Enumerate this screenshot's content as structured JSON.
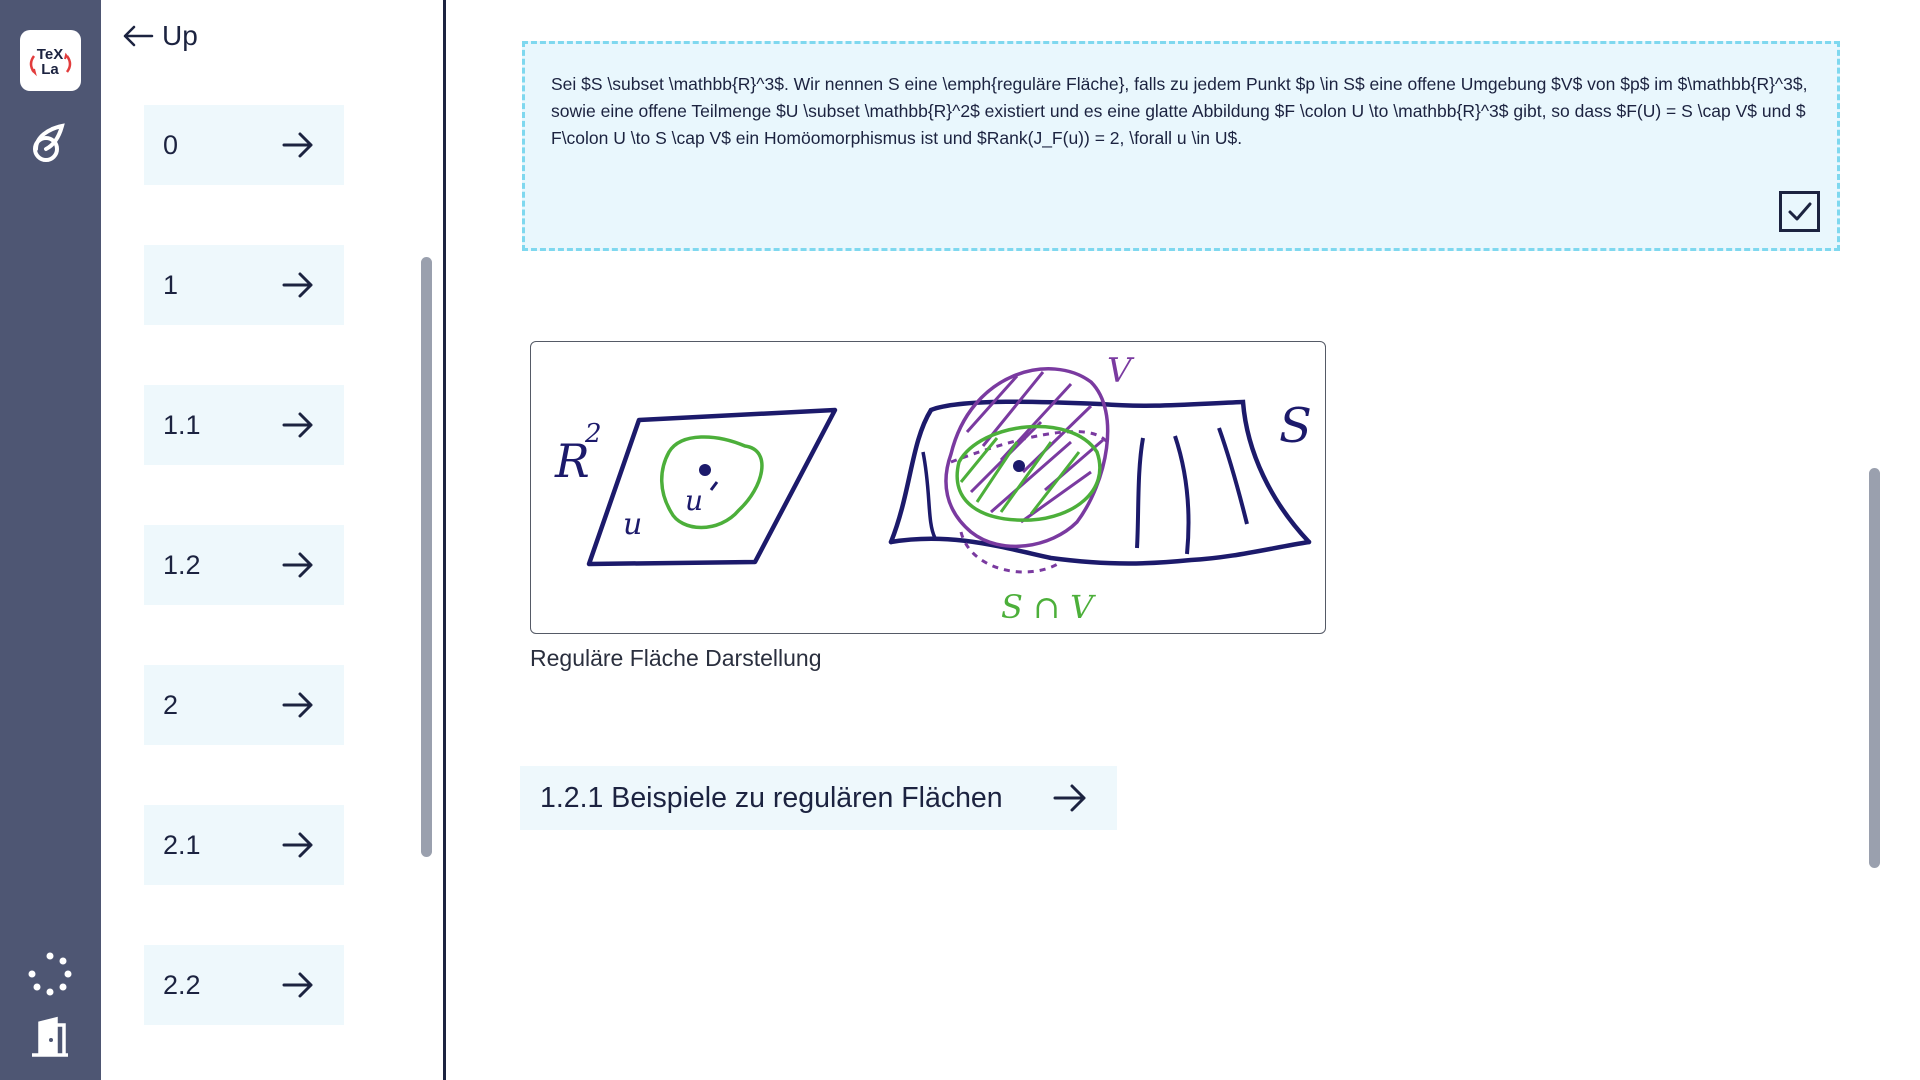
{
  "app": {
    "logo_text": "TeX La",
    "brand_color": "#4e5673",
    "accent_color": "#7fd8ef"
  },
  "rail": {
    "icons": [
      "texla-logo",
      "leaf-icon",
      "loading-spinner-icon",
      "exit-door-icon"
    ]
  },
  "navigation": {
    "up_label": "Up",
    "sections": [
      {
        "label": "0"
      },
      {
        "label": "1"
      },
      {
        "label": "1.1"
      },
      {
        "label": "1.2"
      },
      {
        "label": "2"
      },
      {
        "label": "2.1"
      },
      {
        "label": "2.2"
      }
    ]
  },
  "content": {
    "definition_text": "Sei $S \\subset \\mathbb{R}^3$. Wir nennen S eine \\emph{reguläre Fläche}, falls zu jedem Punkt $p \\in S$ eine offene Umgebung $V$ von $p$ im $\\mathbb{R}^3$, sowie eine offene Teilmenge $U \\subset \\mathbb{R}^2$ existiert und es eine glatte Abbildung $F \\colon U \\to \\mathbb{R}^3$ gibt, so dass $F(U) = S \\cap V$ und $ F\\colon U \\to S \\cap V$ ein Homöomorphismus ist und $Rank(J_F(u)) = 2, \\forall u \\in U$.",
    "checked": true,
    "figure": {
      "caption": "Reguläre Fläche Darstellung",
      "labels": {
        "r2": "R",
        "r2_exp": "2",
        "u": "u",
        "u_prime": "u",
        "s": "S",
        "v": "V",
        "s_cap_v": "S ∩ V"
      }
    },
    "subsection_link": "1.2.1 Beispiele zu regulären Flächen"
  }
}
